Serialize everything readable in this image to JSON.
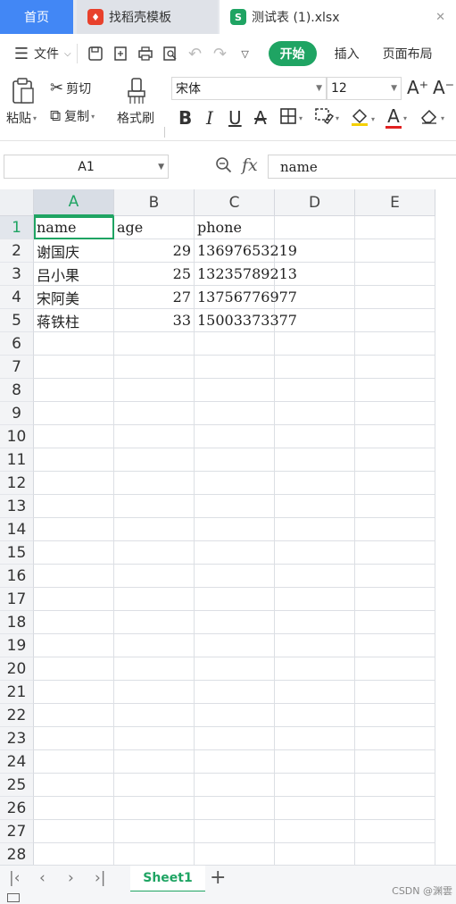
{
  "tabs": {
    "home": "首页",
    "template": "找稻壳模板",
    "file": "测试表 (1).xlsx",
    "file_icon_letter": "S",
    "close": "✕"
  },
  "menu": {
    "file_label": "文件",
    "active_tab": "开始",
    "insert": "插入",
    "layout": "页面布局"
  },
  "ribbon": {
    "paste": "粘贴",
    "cut": "剪切",
    "copy": "复制",
    "format_painter": "格式刷",
    "font_name": "宋体",
    "font_size": "12",
    "bold": "B",
    "italic": "I",
    "underline": "U",
    "strike": "A",
    "font_color_letter": "A",
    "grow": "A⁺",
    "shrink": "A⁻"
  },
  "formula_bar": {
    "cell_ref": "A1",
    "fx": "fx",
    "content": "name"
  },
  "grid": {
    "columns": [
      "A",
      "B",
      "C",
      "D",
      "E"
    ],
    "rows": [
      [
        "name",
        "age",
        "phone"
      ],
      [
        "谢国庆",
        "29",
        "13697653219"
      ],
      [
        "吕小果",
        "25",
        "13235789213"
      ],
      [
        "宋阿美",
        "27",
        "13756776977"
      ],
      [
        "蒋铁柱",
        "33",
        "15003373377"
      ]
    ]
  },
  "sheets": {
    "active": "Sheet1",
    "add": "+"
  },
  "watermark": "CSDN @渊雲",
  "colors": {
    "accent": "#1fa463",
    "home_tab": "#4287f5",
    "font_color_bar": "#e02020",
    "fill_color_bar": "#f5d000"
  }
}
